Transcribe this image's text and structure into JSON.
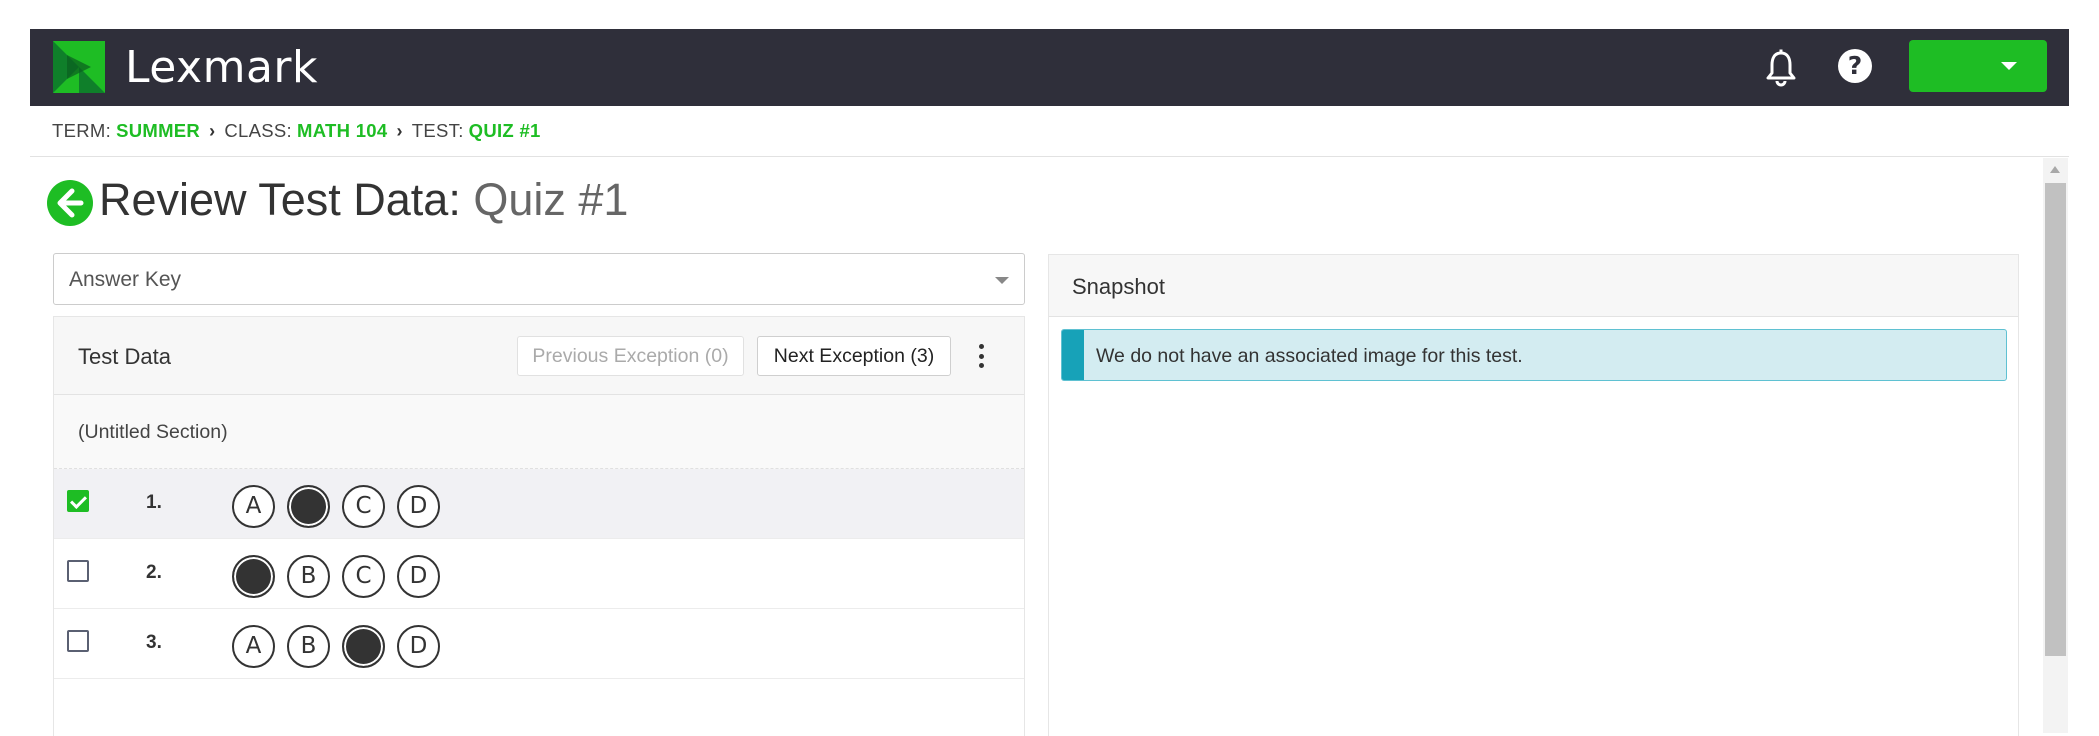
{
  "brand": {
    "name": "Lexmark",
    "accent": "#1ebd24",
    "header_bg": "#2f2f3a"
  },
  "header": {
    "icons": [
      "bell-icon",
      "help-icon"
    ],
    "help_glyph": "?",
    "user_menu_label": ""
  },
  "breadcrumb": {
    "items": [
      {
        "label": "TERM:",
        "value": "SUMMER"
      },
      {
        "label": "CLASS:",
        "value": "MATH 104"
      },
      {
        "label": "TEST:",
        "value": "QUIZ #1"
      }
    ]
  },
  "page": {
    "title": "Review Test Data:",
    "subtitle": "Quiz #1"
  },
  "key_select": {
    "value": "Answer Key"
  },
  "test_data": {
    "title": "Test Data",
    "prev_exception_label": "Previous Exception (0)",
    "next_exception_label": "Next Exception (3)",
    "section_title": "(Untitled Section)",
    "questions": [
      {
        "number": "1.",
        "checked": true,
        "options": [
          "A",
          "B",
          "C",
          "D"
        ],
        "filled_index": 1
      },
      {
        "number": "2.",
        "checked": false,
        "options": [
          "A",
          "B",
          "C",
          "D"
        ],
        "filled_index": 0
      },
      {
        "number": "3.",
        "checked": false,
        "options": [
          "A",
          "B",
          "C",
          "D"
        ],
        "filled_index": 2
      }
    ]
  },
  "snapshot": {
    "title": "Snapshot",
    "alert_text": "We do not have an associated image for this test.",
    "alert_color": "#17a2b8"
  }
}
